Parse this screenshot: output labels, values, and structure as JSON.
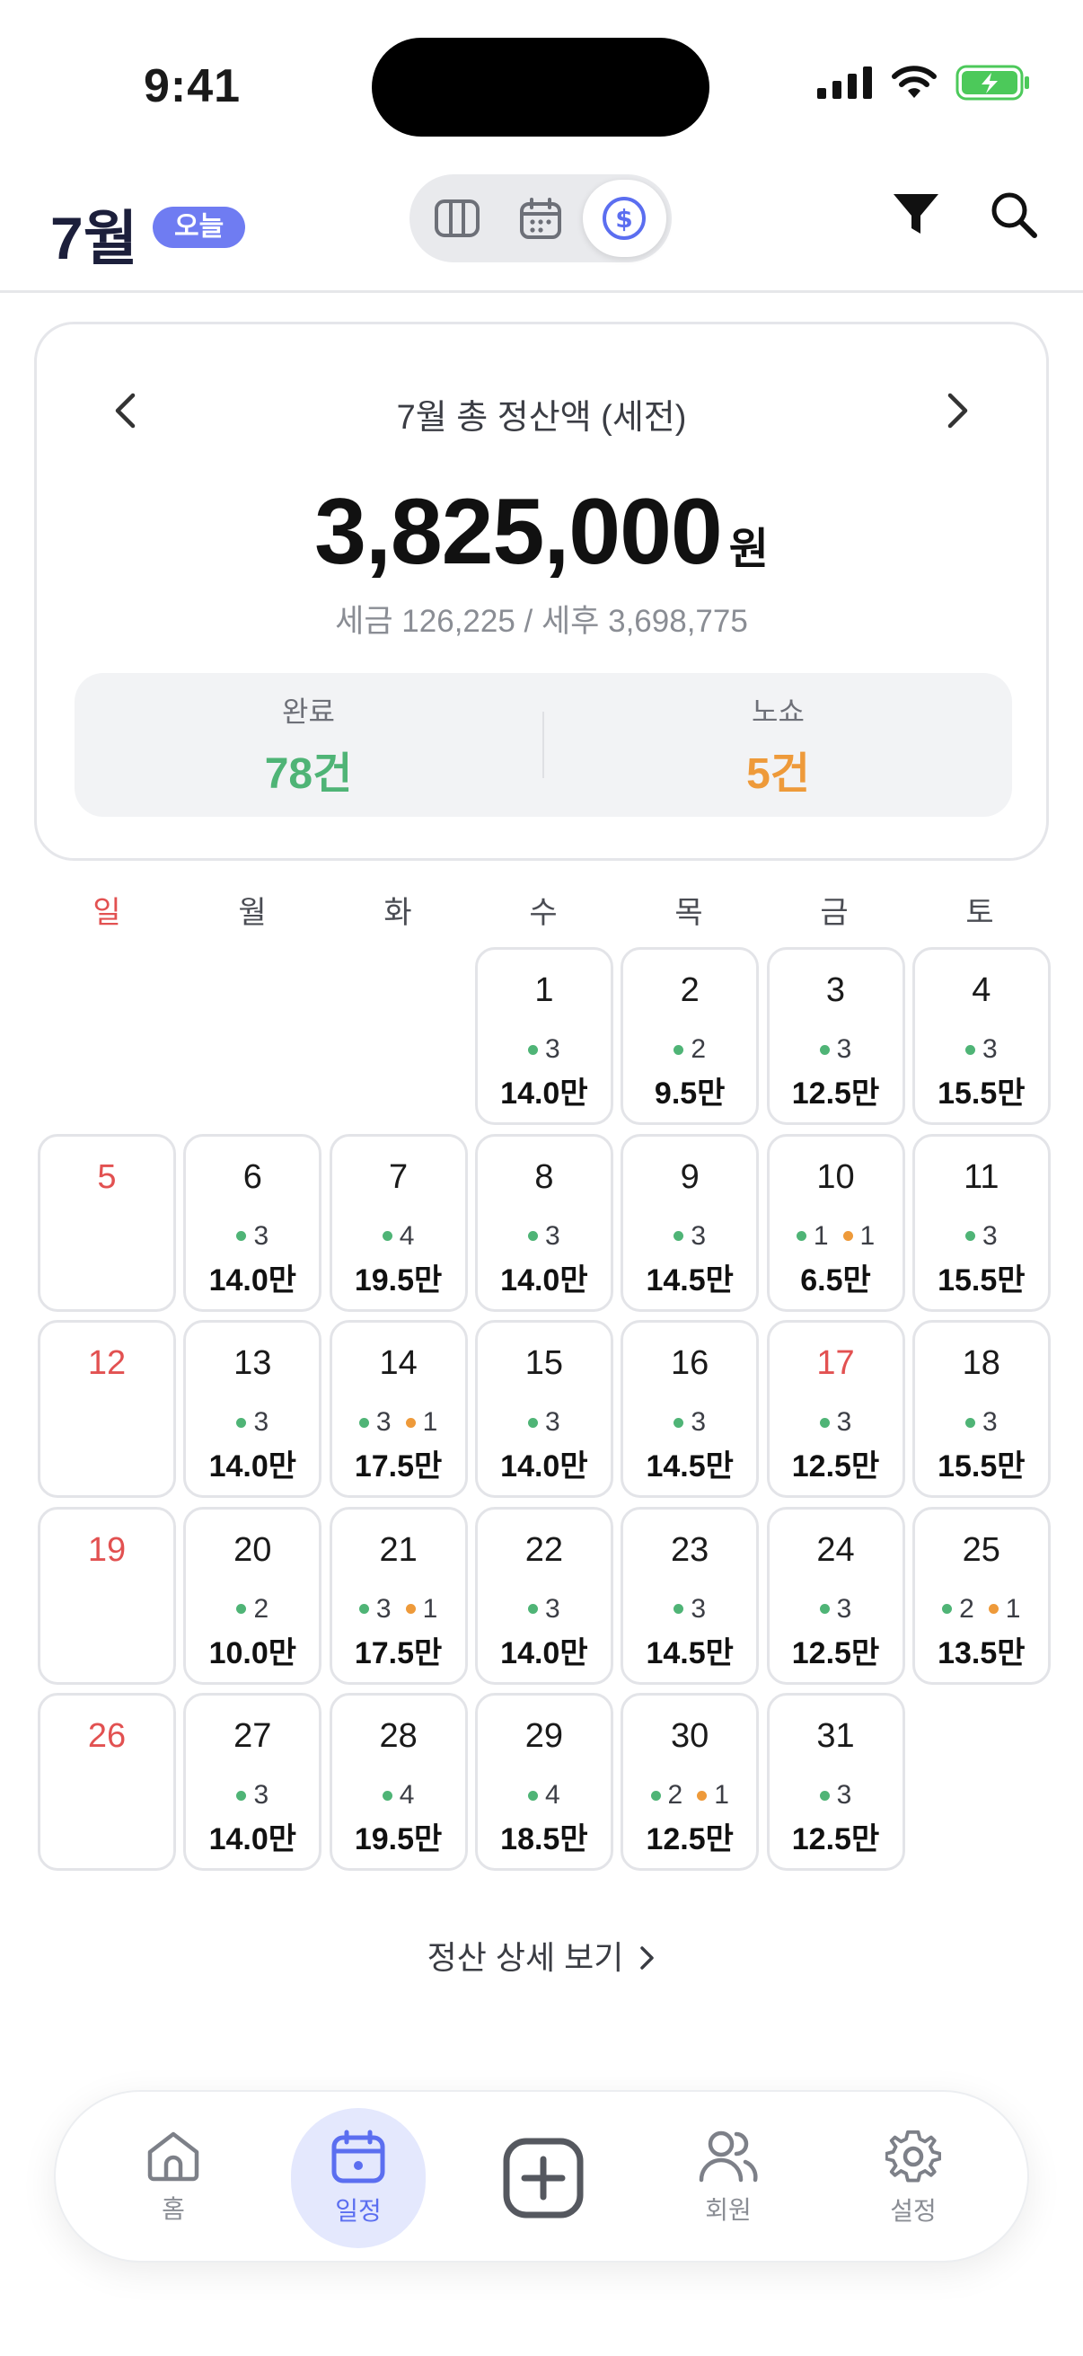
{
  "status_bar": {
    "time": "9:41"
  },
  "header": {
    "month": "7월",
    "today_label": "오늘",
    "view_modes": [
      "columns-icon",
      "calendar-icon",
      "dollar-icon"
    ],
    "active_view": "dollar-icon"
  },
  "summary": {
    "title": "7월 총 정산액 (세전)",
    "amount": "3,825,000",
    "unit": "원",
    "tax_line": "세금 126,225 / 세후 3,698,775",
    "completed_label": "완료",
    "completed_value": "78건",
    "noshow_label": "노쇼",
    "noshow_value": "5건"
  },
  "calendar": {
    "weekdays": [
      "일",
      "월",
      "화",
      "수",
      "목",
      "금",
      "토"
    ],
    "days": [
      {
        "day": "1",
        "col": 3,
        "row": 0,
        "done": "3",
        "noshow": "",
        "amount": "14.0만"
      },
      {
        "day": "2",
        "col": 4,
        "row": 0,
        "done": "2",
        "noshow": "",
        "amount": "9.5만"
      },
      {
        "day": "3",
        "col": 5,
        "row": 0,
        "done": "3",
        "noshow": "",
        "amount": "12.5만"
      },
      {
        "day": "4",
        "col": 6,
        "row": 0,
        "done": "3",
        "noshow": "",
        "amount": "15.5만"
      },
      {
        "day": "5",
        "col": 0,
        "row": 1,
        "done": "",
        "noshow": "",
        "amount": "",
        "red": true
      },
      {
        "day": "6",
        "col": 1,
        "row": 1,
        "done": "3",
        "noshow": "",
        "amount": "14.0만"
      },
      {
        "day": "7",
        "col": 2,
        "row": 1,
        "done": "4",
        "noshow": "",
        "amount": "19.5만"
      },
      {
        "day": "8",
        "col": 3,
        "row": 1,
        "done": "3",
        "noshow": "",
        "amount": "14.0만"
      },
      {
        "day": "9",
        "col": 4,
        "row": 1,
        "done": "3",
        "noshow": "",
        "amount": "14.5만"
      },
      {
        "day": "10",
        "col": 5,
        "row": 1,
        "done": "1",
        "noshow": "1",
        "amount": "6.5만"
      },
      {
        "day": "11",
        "col": 6,
        "row": 1,
        "done": "3",
        "noshow": "",
        "amount": "15.5만"
      },
      {
        "day": "12",
        "col": 0,
        "row": 2,
        "done": "",
        "noshow": "",
        "amount": "",
        "red": true
      },
      {
        "day": "13",
        "col": 1,
        "row": 2,
        "done": "3",
        "noshow": "",
        "amount": "14.0만"
      },
      {
        "day": "14",
        "col": 2,
        "row": 2,
        "done": "3",
        "noshow": "1",
        "amount": "17.5만"
      },
      {
        "day": "15",
        "col": 3,
        "row": 2,
        "done": "3",
        "noshow": "",
        "amount": "14.0만"
      },
      {
        "day": "16",
        "col": 4,
        "row": 2,
        "done": "3",
        "noshow": "",
        "amount": "14.5만"
      },
      {
        "day": "17",
        "col": 5,
        "row": 2,
        "done": "3",
        "noshow": "",
        "amount": "12.5만",
        "red": true
      },
      {
        "day": "18",
        "col": 6,
        "row": 2,
        "done": "3",
        "noshow": "",
        "amount": "15.5만"
      },
      {
        "day": "19",
        "col": 0,
        "row": 3,
        "done": "",
        "noshow": "",
        "amount": "",
        "red": true
      },
      {
        "day": "20",
        "col": 1,
        "row": 3,
        "done": "2",
        "noshow": "",
        "amount": "10.0만"
      },
      {
        "day": "21",
        "col": 2,
        "row": 3,
        "done": "3",
        "noshow": "1",
        "amount": "17.5만"
      },
      {
        "day": "22",
        "col": 3,
        "row": 3,
        "done": "3",
        "noshow": "",
        "amount": "14.0만"
      },
      {
        "day": "23",
        "col": 4,
        "row": 3,
        "done": "3",
        "noshow": "",
        "amount": "14.5만"
      },
      {
        "day": "24",
        "col": 5,
        "row": 3,
        "done": "3",
        "noshow": "",
        "amount": "12.5만"
      },
      {
        "day": "25",
        "col": 6,
        "row": 3,
        "done": "2",
        "noshow": "1",
        "amount": "13.5만"
      },
      {
        "day": "26",
        "col": 0,
        "row": 4,
        "done": "",
        "noshow": "",
        "amount": "",
        "red": true
      },
      {
        "day": "27",
        "col": 1,
        "row": 4,
        "done": "3",
        "noshow": "",
        "amount": "14.0만"
      },
      {
        "day": "28",
        "col": 2,
        "row": 4,
        "done": "4",
        "noshow": "",
        "amount": "19.5만"
      },
      {
        "day": "29",
        "col": 3,
        "row": 4,
        "done": "4",
        "noshow": "",
        "amount": "18.5만"
      },
      {
        "day": "30",
        "col": 4,
        "row": 4,
        "done": "2",
        "noshow": "1",
        "amount": "12.5만"
      },
      {
        "day": "31",
        "col": 5,
        "row": 4,
        "done": "3",
        "noshow": "",
        "amount": "12.5만"
      }
    ]
  },
  "detail_link": "정산 상세 보기",
  "bottom_nav": [
    {
      "key": "home",
      "label": "홈",
      "icon": "home-icon"
    },
    {
      "key": "schedule",
      "label": "일정",
      "icon": "calendar-icon",
      "active": true
    },
    {
      "key": "add",
      "label": "",
      "icon": "add-icon"
    },
    {
      "key": "members",
      "label": "회원",
      "icon": "members-icon"
    },
    {
      "key": "settings",
      "label": "설정",
      "icon": "gear-icon"
    }
  ],
  "colors": {
    "accent": "#5b6ef0",
    "badge": "#6f7cf2",
    "completed": "#4fb476",
    "noshow": "#ee9a3a",
    "sunday": "#e25151",
    "battery": "#4cc95a"
  }
}
